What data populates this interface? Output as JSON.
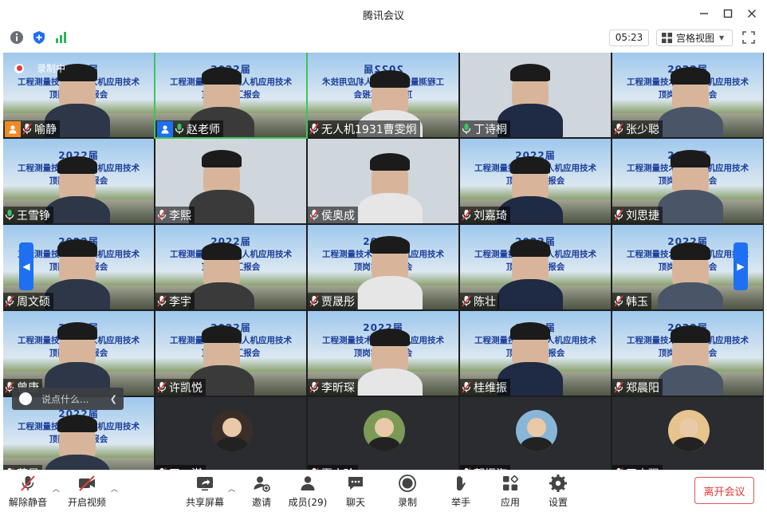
{
  "window": {
    "title": "腾讯会议",
    "controls": [
      "minimize-icon",
      "maximize-icon",
      "close-icon"
    ]
  },
  "toolbar": {
    "timer": "05:23",
    "view_label": "宫格视图",
    "icons": [
      "info-icon",
      "shield-icon",
      "signal-icon",
      "fullscreen-icon"
    ]
  },
  "recording": {
    "label": "录制中"
  },
  "slide": {
    "line1": "2022届",
    "line2": "工程测量技术 & 无人机应用技术",
    "line3": "顶岗实习汇报会"
  },
  "participants": [
    {
      "name": "喻静",
      "host": true
    },
    {
      "name": "赵老师",
      "host": true
    },
    {
      "name": "无人机1931曹雯炯"
    },
    {
      "name": "丁诗桐"
    },
    {
      "name": "张少聪"
    },
    {
      "name": "王雪铮"
    },
    {
      "name": "李熙"
    },
    {
      "name": "侯奥成"
    },
    {
      "name": "刘嘉琦"
    },
    {
      "name": "刘思捷"
    },
    {
      "name": "周文硕"
    },
    {
      "name": "李宇"
    },
    {
      "name": "贾晟彤"
    },
    {
      "name": "陈壮"
    },
    {
      "name": "韩玉"
    },
    {
      "name": "曾康"
    },
    {
      "name": "许凯悦"
    },
    {
      "name": "李昕琛"
    },
    {
      "name": "桂维振"
    },
    {
      "name": "郑晨阳"
    },
    {
      "name": "董晨"
    },
    {
      "name": "王一淇"
    },
    {
      "name": "夏启玲"
    },
    {
      "name": "郭振海"
    },
    {
      "name": "王志强"
    }
  ],
  "chat": {
    "placeholder": "说点什么..."
  },
  "bottom": {
    "unmute": "解除静音",
    "start_video": "开启视频",
    "share_screen": "共享屏幕",
    "invite": "邀请",
    "members": "成员(29)",
    "chat": "聊天",
    "record": "录制",
    "raise_hand": "举手",
    "apps": "应用",
    "settings": "设置",
    "leave": "离开会议"
  },
  "colors": {
    "accent": "#1e6ff2",
    "leave": "#e03b3b",
    "host_badge": "#f08a24",
    "speaking_mic": "#3fc35a"
  }
}
